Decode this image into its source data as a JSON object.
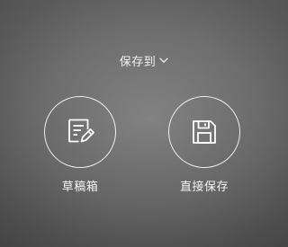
{
  "header": {
    "save_to_label": "保存到",
    "dropdown_icon": "chevron-down-icon"
  },
  "options": [
    {
      "label": "草稿箱",
      "icon": "draft-edit-icon"
    },
    {
      "label": "直接保存",
      "icon": "floppy-disk-icon"
    }
  ],
  "colors": {
    "overlay_background": "#6c6c6c",
    "foreground": "#ffffff"
  }
}
